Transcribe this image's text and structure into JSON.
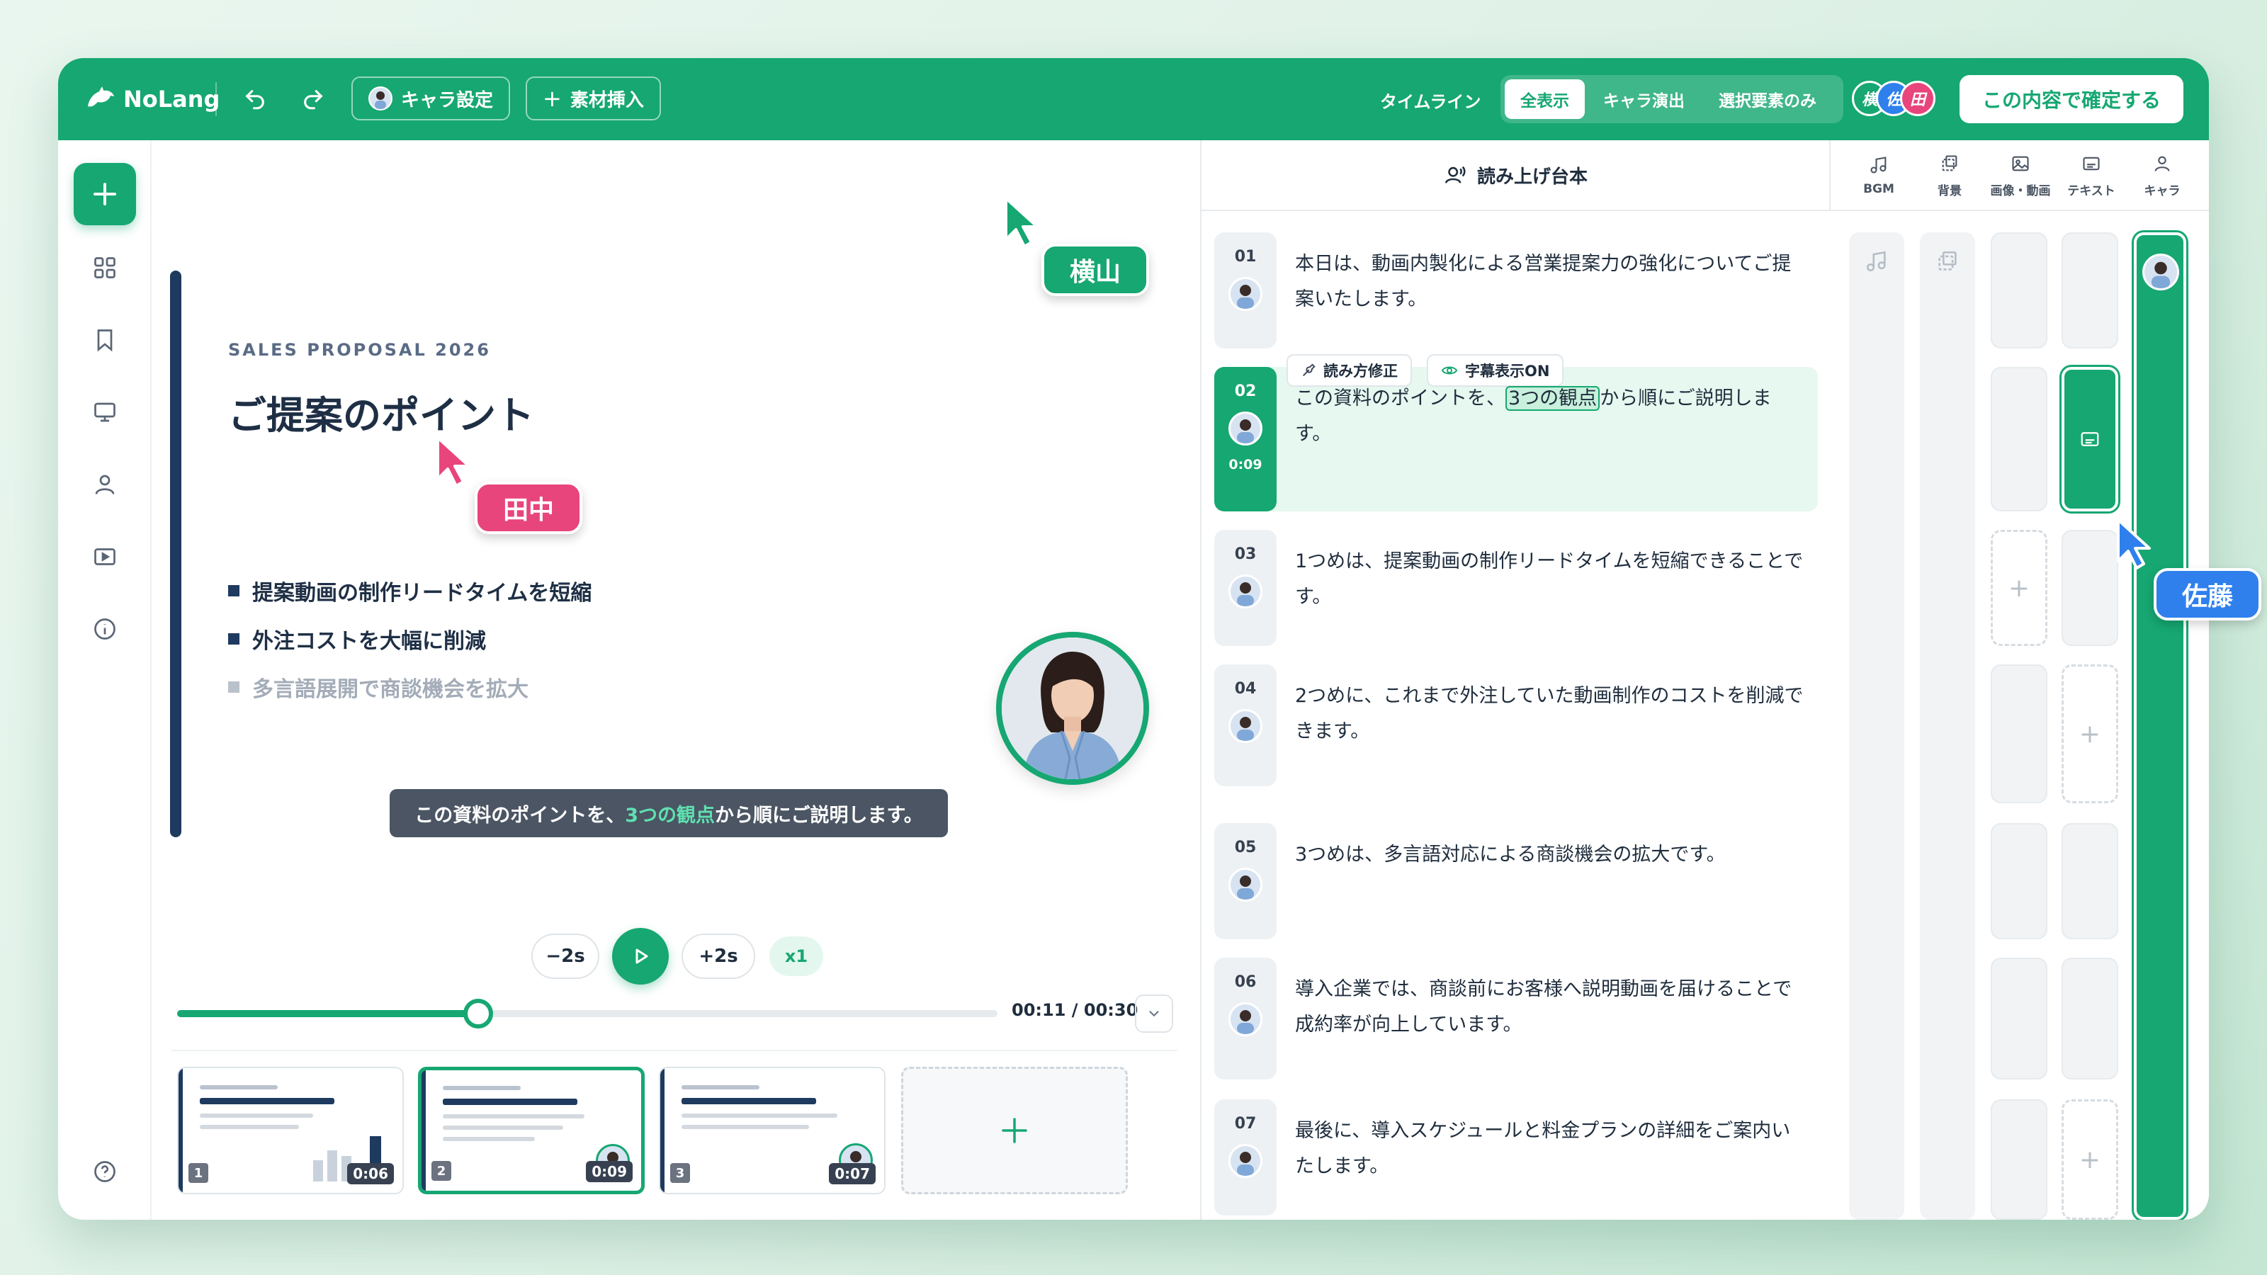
{
  "header": {
    "brand": "NoLang",
    "chara_settings": "キャラ設定",
    "insert_material": "素材挿入",
    "timeline_label": "タイムライン",
    "tabs": [
      "全表示",
      "キャラ演出",
      "選択要素のみ"
    ],
    "users": [
      {
        "initial": "横",
        "color": "#16a772"
      },
      {
        "initial": "佐",
        "color": "#2f80ed"
      },
      {
        "initial": "田",
        "color": "#e8457c"
      }
    ],
    "confirm": "この内容で確定する"
  },
  "slide": {
    "kicker": "SALES PROPOSAL 2026",
    "title": "ご提案のポイント",
    "bullets": [
      "提案動画の制作リードタイムを短縮",
      "外注コストを大幅に削減",
      "多言語展開で商談機会を拡大"
    ],
    "caption_pre": "この資料のポイントを、",
    "caption_hl": "3つの観点",
    "caption_post": "から順にご説明します。"
  },
  "cursors": {
    "yokoyama": {
      "name": "横山",
      "color": "#16a772"
    },
    "tanaka": {
      "name": "田中",
      "color": "#e8457c"
    },
    "sato": {
      "name": "佐藤",
      "color": "#2f80ed"
    }
  },
  "player": {
    "back": "−2s",
    "forward": "+2s",
    "speed": "x1",
    "time": "00:11 / 00:30",
    "progress": 0.3667
  },
  "thumbnails": [
    {
      "num": "1",
      "duration": "0:06"
    },
    {
      "num": "2",
      "duration": "0:09"
    },
    {
      "num": "3",
      "duration": "0:07"
    }
  ],
  "script": {
    "title": "読み上げ台本",
    "columns": [
      "BGM",
      "背景",
      "画像・動画",
      "テキスト",
      "キャラ"
    ],
    "edit_reading": "読み方修正",
    "subtitle_on": "字幕表示ON",
    "rows": [
      {
        "num": "01",
        "text": "本日は、動画内製化による営業提案力の強化についてご提案いたします。"
      },
      {
        "num": "02",
        "pre": "この資料のポイントを、",
        "hl": "3つの観点",
        "post": "から順にご説明します。",
        "time": "0:09"
      },
      {
        "num": "03",
        "text": "1つめは、提案動画の制作リードタイムを短縮できることです。"
      },
      {
        "num": "04",
        "text": "2つめに、これまで外注していた動画制作のコストを削減できます。"
      },
      {
        "num": "05",
        "text": "3つめは、多言語対応による商談機会の拡大です。"
      },
      {
        "num": "06",
        "text": "導入企業では、商談前にお客様へ説明動画を届けることで成約率が向上しています。"
      },
      {
        "num": "07",
        "text": "最後に、導入スケジュールと料金プランの詳細をご案内いたします。"
      }
    ]
  }
}
